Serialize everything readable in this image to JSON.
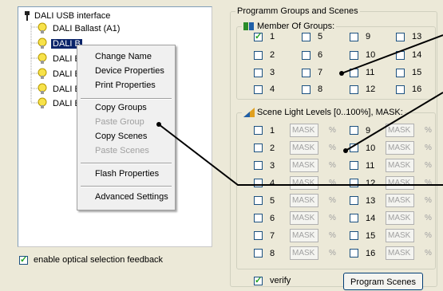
{
  "tree": {
    "root": "DALI USB interface",
    "items": [
      {
        "label": "DALI Ballast (A1)",
        "selected": false
      },
      {
        "label": "DALI B",
        "selected": true
      },
      {
        "label": "DALI E",
        "selected": false
      },
      {
        "label": "DALI E",
        "selected": false
      },
      {
        "label": "DALI E",
        "selected": false
      },
      {
        "label": "DALI E",
        "selected": false
      }
    ]
  },
  "context_menu": {
    "items": [
      {
        "label": "Change Name",
        "enabled": true
      },
      {
        "label": "Device Properties",
        "enabled": true
      },
      {
        "label": "Print Properties",
        "enabled": true
      },
      {
        "label": "Copy Groups",
        "enabled": true
      },
      {
        "label": "Paste Group",
        "enabled": false
      },
      {
        "label": "Copy Scenes",
        "enabled": true
      },
      {
        "label": "Paste Scenes",
        "enabled": false
      },
      {
        "label": "Flash Properties",
        "enabled": true
      },
      {
        "label": "Advanced Settings",
        "enabled": true
      }
    ]
  },
  "optical_feedback": {
    "label": "enable optical selection feedback",
    "checked": true
  },
  "right_panel": {
    "title": "Programm Groups and Scenes",
    "groups": {
      "title": "Member Of Groups:",
      "items": [
        {
          "label": "1",
          "checked": true
        },
        {
          "label": "5",
          "checked": false
        },
        {
          "label": "9",
          "checked": false
        },
        {
          "label": "13",
          "checked": false
        },
        {
          "label": "2",
          "checked": false
        },
        {
          "label": "6",
          "checked": false
        },
        {
          "label": "10",
          "checked": false
        },
        {
          "label": "14",
          "checked": false
        },
        {
          "label": "3",
          "checked": false
        },
        {
          "label": "7",
          "checked": false
        },
        {
          "label": "11",
          "checked": false
        },
        {
          "label": "15",
          "checked": false
        },
        {
          "label": "4",
          "checked": false
        },
        {
          "label": "8",
          "checked": false
        },
        {
          "label": "12",
          "checked": false
        },
        {
          "label": "16",
          "checked": false
        }
      ]
    },
    "scenes": {
      "title": "Scene Light Levels [0..100%], MASK:",
      "mask_text": "MASK",
      "unit": "%",
      "items": [
        {
          "label": "1"
        },
        {
          "label": "9"
        },
        {
          "label": "2"
        },
        {
          "label": "10"
        },
        {
          "label": "3"
        },
        {
          "label": "11"
        },
        {
          "label": "4"
        },
        {
          "label": "12"
        },
        {
          "label": "5"
        },
        {
          "label": "13"
        },
        {
          "label": "6"
        },
        {
          "label": "14"
        },
        {
          "label": "7"
        },
        {
          "label": "15"
        },
        {
          "label": "8"
        },
        {
          "label": "16"
        }
      ]
    },
    "verify": {
      "label": "verify",
      "checked": true
    },
    "program_button": "Program Scenes"
  },
  "colors": {
    "window_bg": "#ece9d8",
    "selection": "#0a246a",
    "disabled_text": "#a0a0a0",
    "check_green": "#21a121"
  }
}
